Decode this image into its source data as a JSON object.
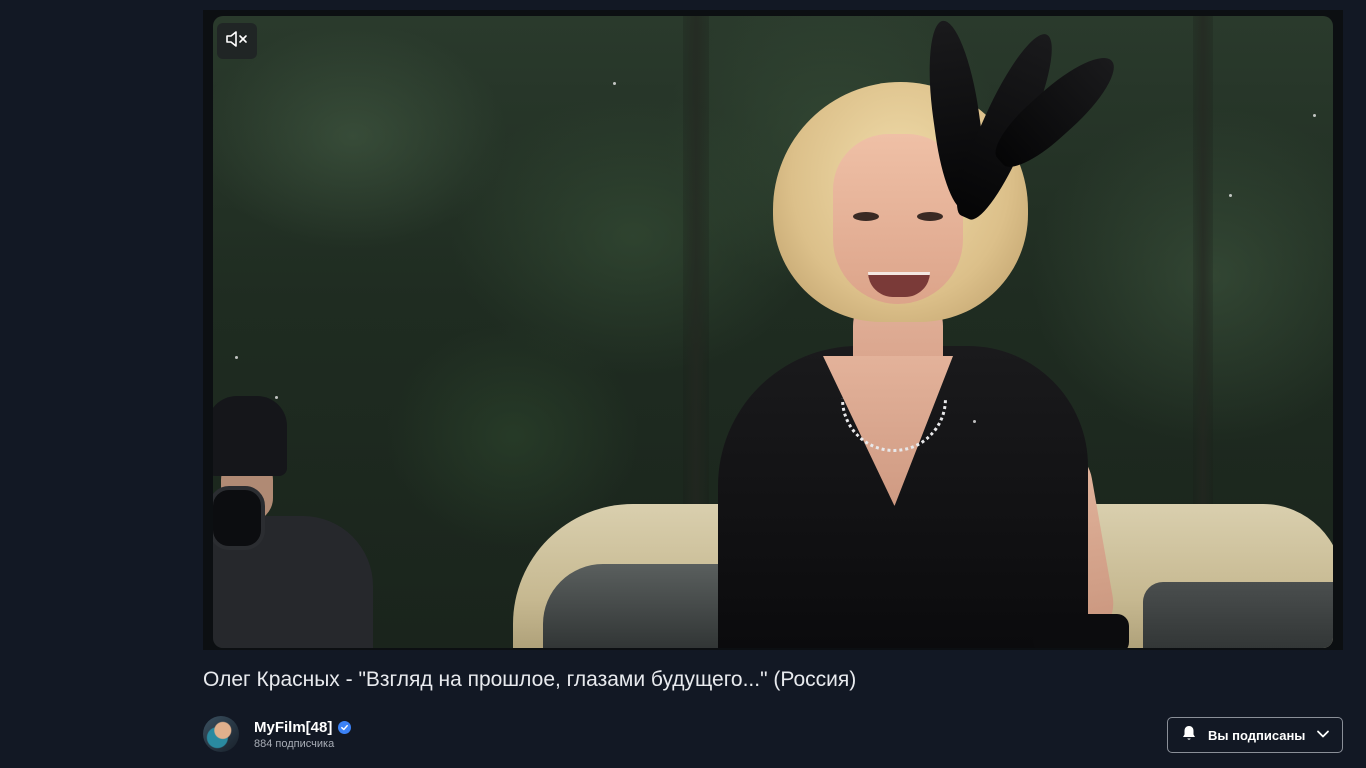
{
  "player": {
    "mute_icon": "speaker-muted-icon"
  },
  "video": {
    "title": "Олег Красных - \"Взгляд на прошлое, глазами будущего...\" (Россия)"
  },
  "channel": {
    "name": "MyFilm[48]",
    "subscribers": "884 подписчика",
    "verified_icon": "verified-check-icon",
    "avatar_icon": "channel-avatar"
  },
  "subscribe": {
    "label": "Вы подписаны",
    "bell_icon": "bell-icon",
    "chevron_icon": "chevron-down-icon"
  },
  "colors": {
    "background": "#121824",
    "text": "#e8eaee",
    "muted_text": "#a8adb6",
    "verified": "#3b82f6",
    "button_border": "#8a8f98"
  }
}
